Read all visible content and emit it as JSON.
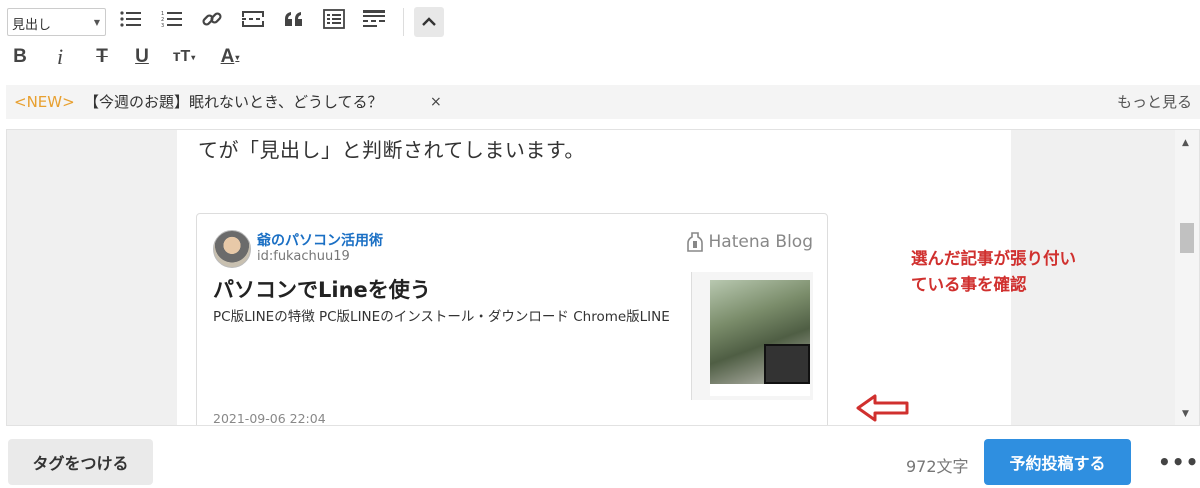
{
  "toolbar": {
    "format_select_value": "見出し",
    "row1_icons": [
      "bulleted-list-icon",
      "numbered-list-icon",
      "link-icon",
      "page-break-icon",
      "quote-icon",
      "table-of-contents-icon",
      "more-tag-icon"
    ],
    "row2": {
      "bold": "B",
      "italic": "i",
      "strike": "T",
      "underline": "U",
      "text_size": "тT",
      "text_color": "A"
    }
  },
  "topic": {
    "new_label": "<NEW>",
    "title": "【今週のお題】眠れないとき、どうしてる？",
    "close": "×",
    "more_link": "もっと見る"
  },
  "editor": {
    "body_text": "てが「見出し」と判断されてしまいます。",
    "card": {
      "blog_name": "爺のパソコン活用術",
      "blog_id": "id:fukachuu19",
      "brand": "Hatena Blog",
      "title": "パソコンでLineを使う",
      "description": "PC版LINEの特徴 PC版LINEのインストール・ダウンロード Chrome版LINE",
      "date": "2021-09-06 22:04"
    },
    "annotation": {
      "line1": "選んだ記事が張り付い",
      "line2": "ている事を確認",
      "color": "#d0302e"
    }
  },
  "footer": {
    "tag_button": "タグをつける",
    "char_count": "972文字",
    "schedule_button": "予約投稿する",
    "more_button": "•••"
  },
  "colors": {
    "accent": "#2f8fe0",
    "new_badge": "#e8a030",
    "link": "#1a6fc4"
  }
}
